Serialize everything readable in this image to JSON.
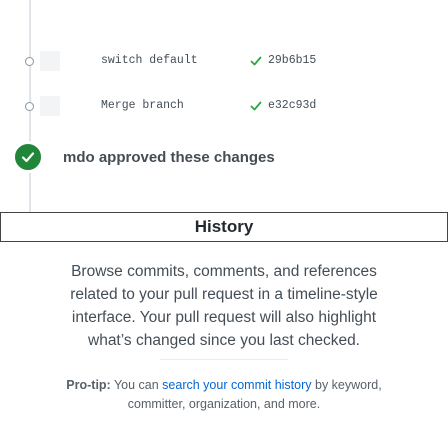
{
  "timeline": {
    "commits": [
      {
        "message": "switch default",
        "sha": "29b6b15",
        "status_icon": "check-icon",
        "status_color": "#28a745"
      },
      {
        "message": "Merge branch",
        "sha": "e32c93d",
        "status_icon": "check-icon",
        "status_color": "#28a745"
      }
    ],
    "review": {
      "text": "mdo approved these changes",
      "icon": "check-icon",
      "badge_color": "#22863a"
    }
  },
  "history": {
    "title": "History",
    "description_lines": [
      "Browse commits, comments, and references",
      "related to your pull request in a timeline-style",
      "interface. Your pull request will also highlight",
      "what’s changed since you last checked."
    ],
    "protip": {
      "label": "Pro-tip:",
      "text_before": " You can ",
      "link_text": "search your commit history",
      "text_after": " by keyword,",
      "line2": "committer, organization, and more."
    }
  },
  "colors": {
    "link": "#0366d6",
    "success": "#28a745",
    "timeline": "#e1e4e8"
  }
}
